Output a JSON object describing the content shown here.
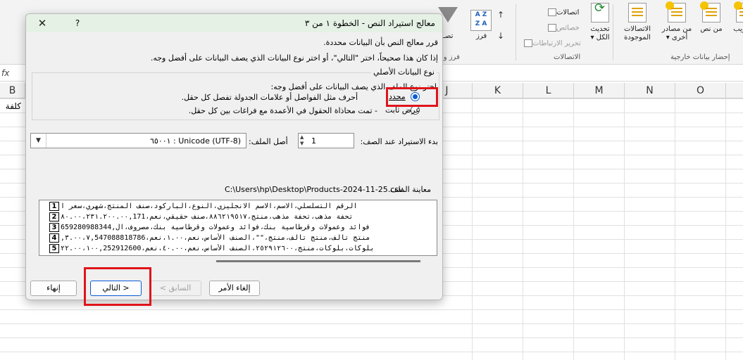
{
  "ribbon": {
    "groups": {
      "get_external": "إحضار بيانات خارجية",
      "connections": "الاتصالات",
      "sort_filter": "فرز وتـ"
    },
    "buttons": {
      "from_web": "من ويب",
      "from_text": "من نص",
      "from_other_line1": "من مصادر",
      "from_other_line2": "أخرى ▾",
      "existing_line1": "الاتصالات",
      "existing_line2": "الموجودة",
      "refresh_line1": "تحديث",
      "refresh_line2": "الكل ▾",
      "connections": "اتصالات",
      "properties": "خصائص",
      "edit_links": "تحرير الارتباطات",
      "sort": "فرز",
      "filter_fragment": "تصـ"
    }
  },
  "grid": {
    "columns": [
      "B",
      "J",
      "K",
      "L",
      "M",
      "N",
      "O"
    ],
    "cell_b2": "كلفة"
  },
  "dialog": {
    "title": "معالج استيراد النص - الخطوة ١ من ٣",
    "help_label": "?",
    "close_label": "✕",
    "intro_line1": "قرر معالج النص بأن البيانات محددة.",
    "intro_line2": "إذا كان هذا صحيحاً، اختر \"التالي\"، أو اختر نوع البيانات الذي يصف البيانات على أفضل وجه.",
    "data_type": {
      "legend": "نوع البيانات الأصلي",
      "choose_label": "اختر نوع الملف الذي يصف البيانات على أفضل وجه:",
      "option_delimited": {
        "label": "محدد",
        "description": "أحرف مثل الفواصل أو علامات الجدولة تفصل كل حقل.",
        "checked": true
      },
      "option_fixed": {
        "label": "عرض ثابت",
        "description": "- تمت محاذاة الحقول في الأعمدة مع فراغات بين كل حقل.",
        "checked": false
      }
    },
    "start_row": {
      "label": "بدء الاستيراد عند الصف:",
      "value": "1"
    },
    "file_origin": {
      "label": "أصل الملف:",
      "value": "٦٥٠٠١ : Unicode (UTF-8)"
    },
    "preview": {
      "label": "معاينة الملف",
      "path": "C:\\Users\\hp\\Desktop\\Products-2024-11-25.csv",
      "rows": [
        {
          "num": "1",
          "text": "الرقم التسلسلي،الاسم،الاسم الانجليزي،النوع،الباركود،صنف المنتج،شهري،سعر ا"
        },
        {
          "num": "2",
          "text": "تحفة مذهب،تحفة مذهب،منتج،٨٨٦٢١٩٥١٧،صنف حقيقي،نعم،٨٠.٠٠،٢٣١.٢٠٠.٠٠,171"
        },
        {
          "num": "3",
          "text": "فوائد وعمولات وقرطاسية بنك،فوائد وعمولات وقرطاسية بنك،مصروف،ال,659280988344"
        },
        {
          "num": "4",
          "text": "منتج تالف،منتج تالف،منتج،\"\"،الصنف الأساس،نعم،١.٠٠،نعم،٣.٠٠،٧,547088818786,"
        },
        {
          "num": "5",
          "text": "بلوكات،بلوكات،منتج،٢٥٢٩١٢٦٠٠،الصنف الأساس،نعم،٤٠.٠٠،نعم،٢٢.٠٠،١٠٠,252912600"
        }
      ]
    },
    "buttons": {
      "cancel": "إلغاء الأمر",
      "back": "< السابق",
      "next": "التالي >",
      "finish": "إنهاء"
    }
  },
  "colors": {
    "accent": "#0a5bd8",
    "highlight": "#e0141b",
    "titlebar": "#e6f1e6"
  }
}
